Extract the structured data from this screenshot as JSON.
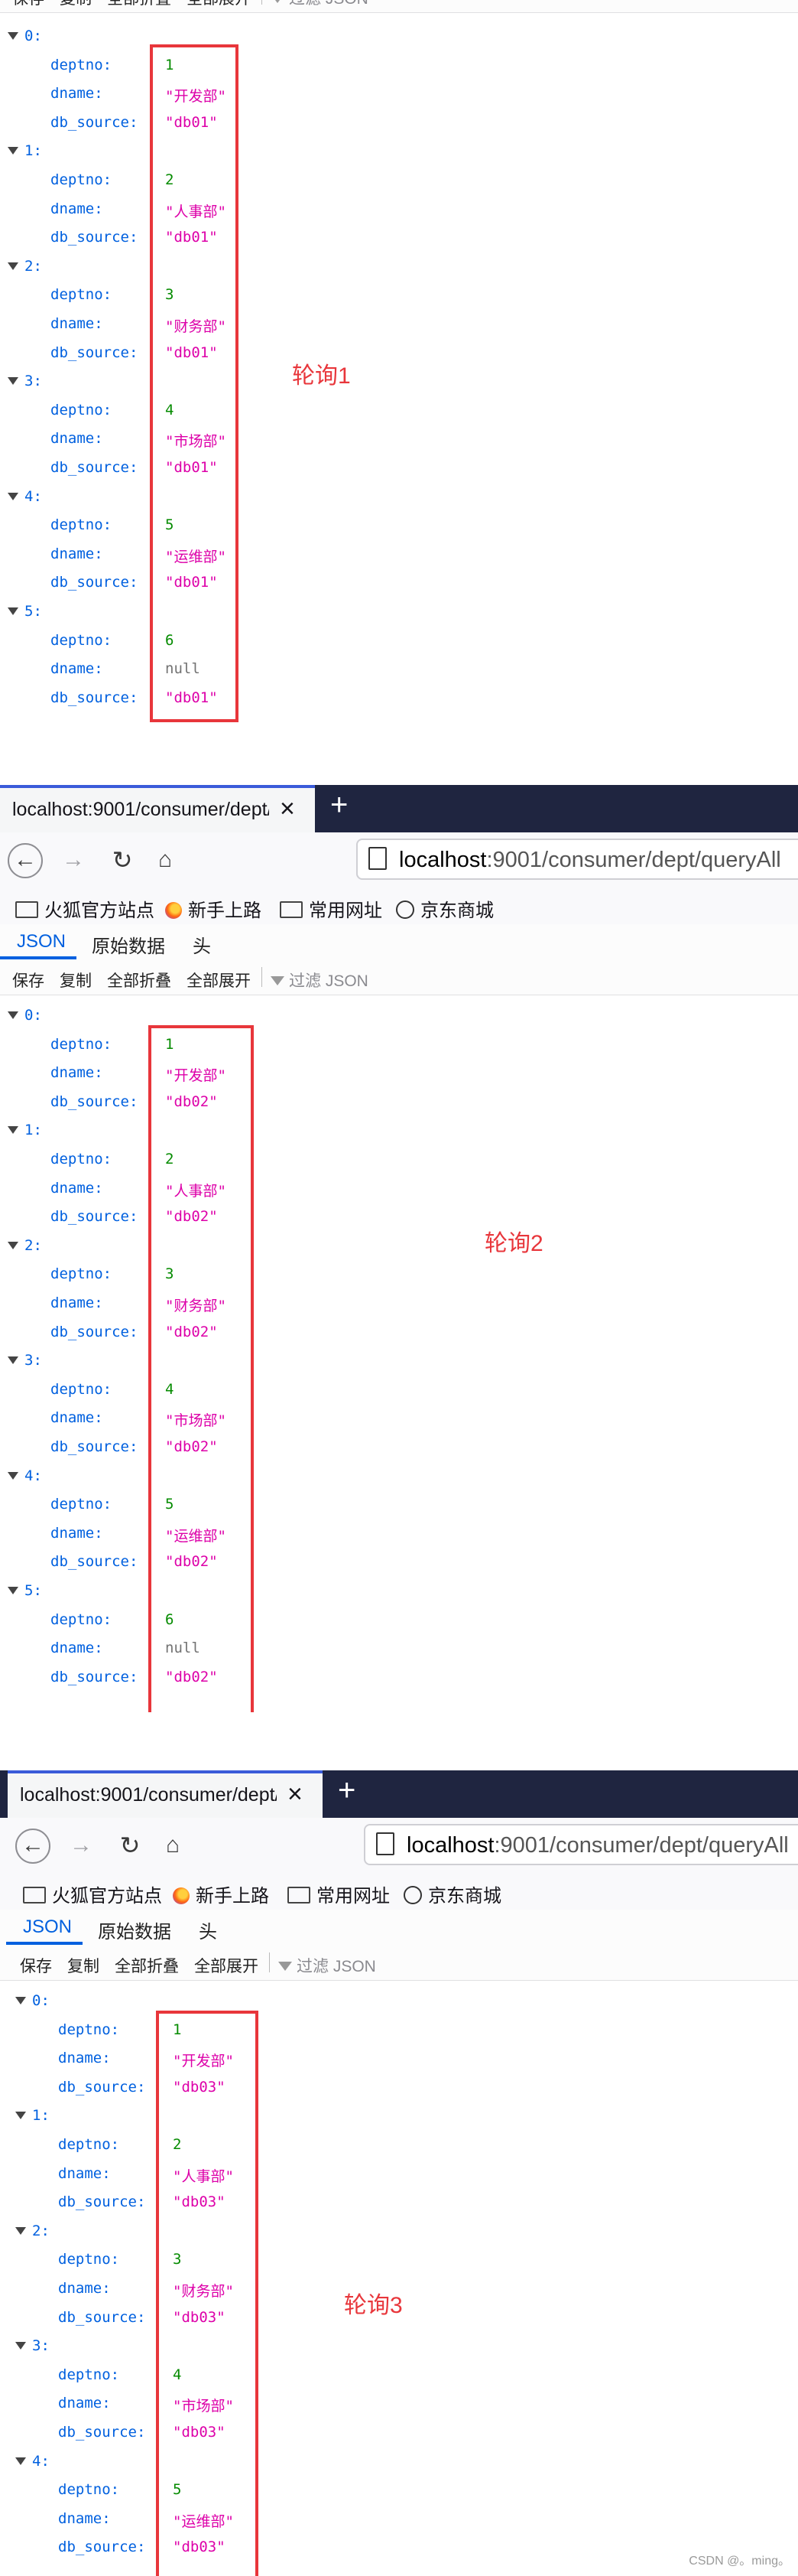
{
  "browser": {
    "tab_title": "localhost:9001/consumer/dept/c",
    "url_host": "localhost",
    "url_path": ":9001/consumer/dept/queryAll",
    "bookmarks": [
      {
        "label": "火狐官方站点",
        "icon": "folder-icon"
      },
      {
        "label": "新手上路",
        "icon": "firefox-icon"
      },
      {
        "label": "常用网址",
        "icon": "folder-icon"
      },
      {
        "label": "京东商城",
        "icon": "globe-icon"
      }
    ]
  },
  "json_viewer": {
    "tabs": [
      "JSON",
      "原始数据",
      "头"
    ],
    "toolbar": {
      "save": "保存",
      "copy": "复制",
      "collapse_all": "全部折叠",
      "expand_all": "全部展开",
      "filter_placeholder": "过滤 JSON"
    }
  },
  "labels": {
    "deptno": "deptno:",
    "dname": "dname:",
    "db_source": "db_source:"
  },
  "screenshots": [
    {
      "caption": "轮询1",
      "records": [
        {
          "index": "0:",
          "deptno": "1",
          "dname": "\"开发部\"",
          "db_source": "\"db01\""
        },
        {
          "index": "1:",
          "deptno": "2",
          "dname": "\"人事部\"",
          "db_source": "\"db01\""
        },
        {
          "index": "2:",
          "deptno": "3",
          "dname": "\"财务部\"",
          "db_source": "\"db01\""
        },
        {
          "index": "3:",
          "deptno": "4",
          "dname": "\"市场部\"",
          "db_source": "\"db01\""
        },
        {
          "index": "4:",
          "deptno": "5",
          "dname": "\"运维部\"",
          "db_source": "\"db01\""
        },
        {
          "index": "5:",
          "deptno": "6",
          "dname": "null",
          "db_source": "\"db01\""
        }
      ]
    },
    {
      "caption": "轮询2",
      "records": [
        {
          "index": "0:",
          "deptno": "1",
          "dname": "\"开发部\"",
          "db_source": "\"db02\""
        },
        {
          "index": "1:",
          "deptno": "2",
          "dname": "\"人事部\"",
          "db_source": "\"db02\""
        },
        {
          "index": "2:",
          "deptno": "3",
          "dname": "\"财务部\"",
          "db_source": "\"db02\""
        },
        {
          "index": "3:",
          "deptno": "4",
          "dname": "\"市场部\"",
          "db_source": "\"db02\""
        },
        {
          "index": "4:",
          "deptno": "5",
          "dname": "\"运维部\"",
          "db_source": "\"db02\""
        },
        {
          "index": "5:",
          "deptno": "6",
          "dname": "null",
          "db_source": "\"db02\""
        }
      ]
    },
    {
      "caption": "轮询3",
      "records": [
        {
          "index": "0:",
          "deptno": "1",
          "dname": "\"开发部\"",
          "db_source": "\"db03\""
        },
        {
          "index": "1:",
          "deptno": "2",
          "dname": "\"人事部\"",
          "db_source": "\"db03\""
        },
        {
          "index": "2:",
          "deptno": "3",
          "dname": "\"财务部\"",
          "db_source": "\"db03\""
        },
        {
          "index": "3:",
          "deptno": "4",
          "dname": "\"市场部\"",
          "db_source": "\"db03\""
        },
        {
          "index": "4:",
          "deptno": "5",
          "dname": "\"运维部\"",
          "db_source": "\"db03\""
        }
      ]
    }
  ],
  "watermark": "CSDN @。ming。",
  "colors": {
    "highlight": "#e8363b",
    "json_key": "#0060df",
    "json_number": "#058b00",
    "json_string": "#dd00a9",
    "json_null": "#737373"
  }
}
